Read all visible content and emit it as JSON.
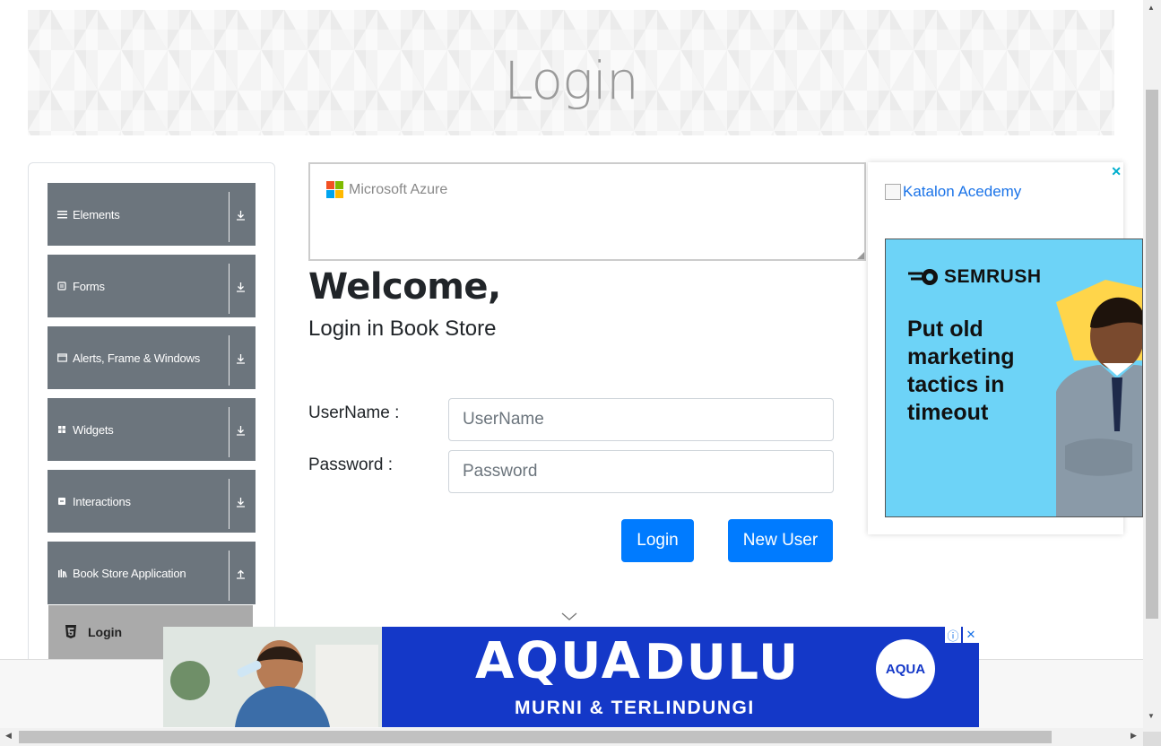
{
  "header": {
    "title": "Login"
  },
  "sidebar": {
    "groups": [
      {
        "label": "Elements",
        "icon": "hamburger-icon",
        "arrow": "download-icon"
      },
      {
        "label": "Forms",
        "icon": "form-icon",
        "arrow": "download-icon"
      },
      {
        "label": "Alerts, Frame & Windows",
        "icon": "window-icon",
        "arrow": "download-icon"
      },
      {
        "label": "Widgets",
        "icon": "grid-icon",
        "arrow": "download-icon"
      },
      {
        "label": "Interactions",
        "icon": "interaction-icon",
        "arrow": "download-icon"
      },
      {
        "label": "Book Store Application",
        "icon": "books-icon",
        "arrow": "upload-icon"
      }
    ],
    "active_item": {
      "label": "Login",
      "icon": "html5-icon"
    }
  },
  "ads": {
    "azure": {
      "brand": "Microsoft Azure"
    },
    "right": {
      "alt": "Katalon Acedemy",
      "brand": "SEMRUSH",
      "tagline": "Put old marketing tactics in timeout"
    },
    "bottom": {
      "headline": "AQUA",
      "headline2": "DULU",
      "strap": "MURNI & TERLINDUNGI",
      "logo": "AQUA"
    }
  },
  "main": {
    "welcome": "Welcome,",
    "subtitle": "Login in Book Store",
    "username_label": "UserName :",
    "username_placeholder": "UserName",
    "username_value": "",
    "password_label": "Password :",
    "password_placeholder": "Password",
    "password_value": "",
    "login_button": "Login",
    "new_user_button": "New User"
  },
  "colors": {
    "primary": "#007bff",
    "sidebar_group": "#6c757d",
    "active_item": "#aaaaaa",
    "aqua_blue": "#1438c8",
    "semrush_bg": "#6dd3f7"
  }
}
